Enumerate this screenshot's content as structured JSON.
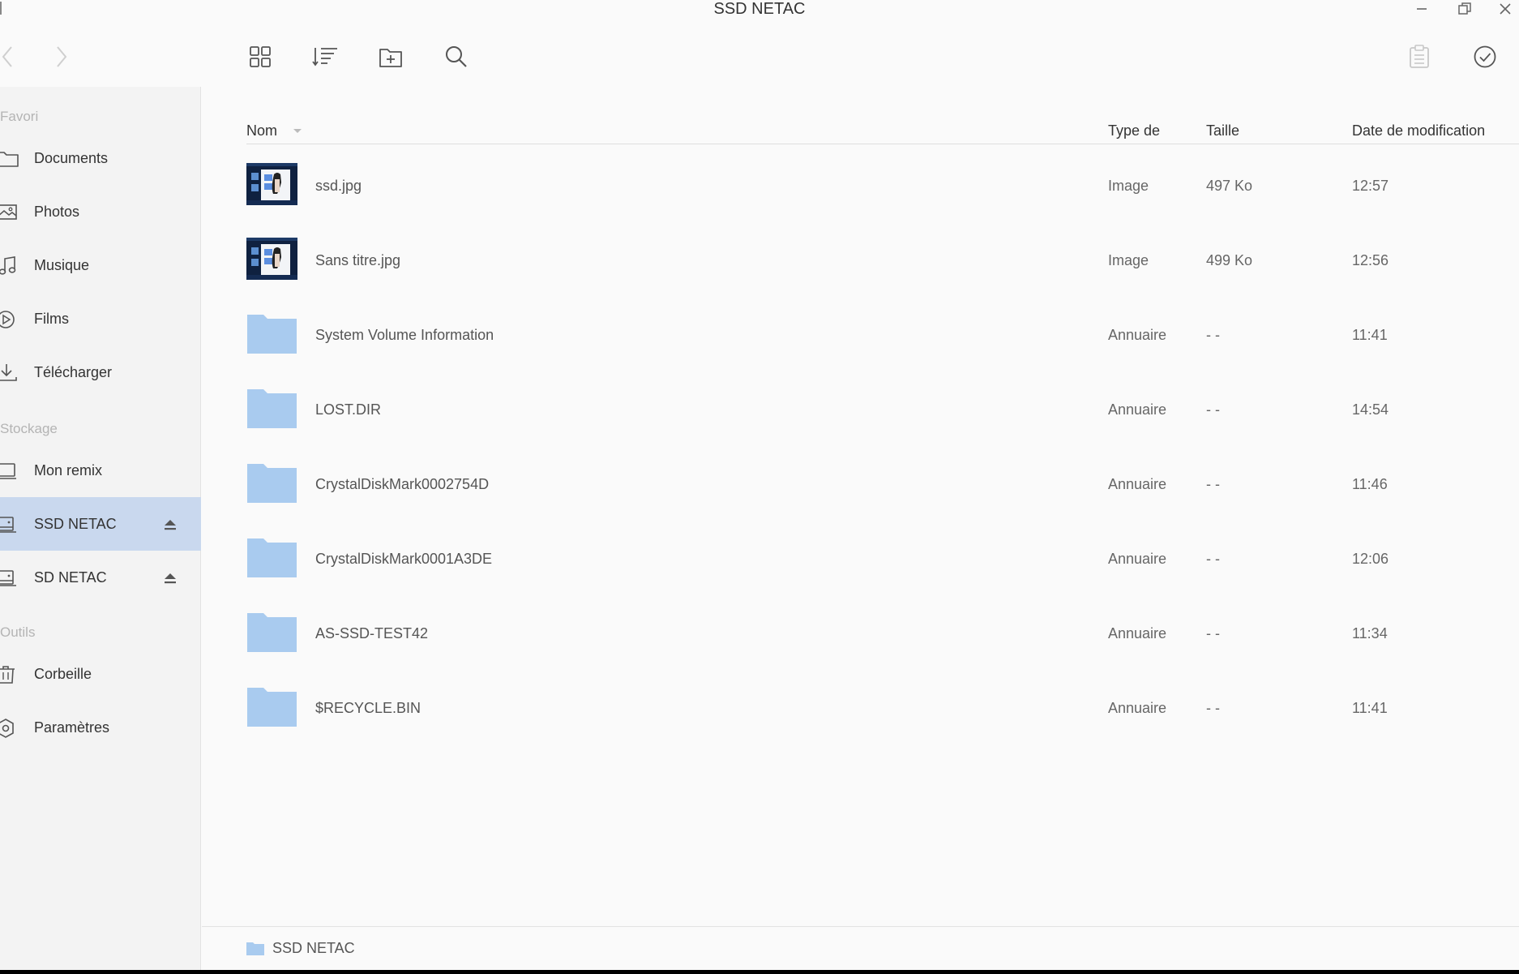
{
  "window": {
    "title": "SSD NETAC"
  },
  "sidebar": {
    "sections": [
      {
        "title": "Favori",
        "items": [
          {
            "label": "Documents",
            "icon": "folder-icon"
          },
          {
            "label": "Photos",
            "icon": "image-icon"
          },
          {
            "label": "Musique",
            "icon": "music-icon"
          },
          {
            "label": "Films",
            "icon": "play-icon"
          },
          {
            "label": "Télécharger",
            "icon": "download-icon"
          }
        ]
      },
      {
        "title": "Stockage",
        "items": [
          {
            "label": "Mon remix",
            "icon": "computer-icon"
          },
          {
            "label": "SSD NETAC",
            "icon": "drive-icon",
            "active": true,
            "eject": true
          },
          {
            "label": "SD NETAC",
            "icon": "drive-icon",
            "eject": true
          }
        ]
      },
      {
        "title": "Outils",
        "items": [
          {
            "label": "Corbeille",
            "icon": "trash-icon"
          },
          {
            "label": "Paramètres",
            "icon": "settings-icon"
          }
        ]
      }
    ]
  },
  "table": {
    "headers": {
      "name": "Nom",
      "type": "Type de",
      "size": "Taille",
      "date": "Date de modification"
    },
    "rows": [
      {
        "name": "ssd.jpg",
        "type": "Image",
        "size": "497 Ko",
        "date": "12:57",
        "kind": "image"
      },
      {
        "name": "Sans titre.jpg",
        "type": "Image",
        "size": "499 Ko",
        "date": "12:56",
        "kind": "image"
      },
      {
        "name": "System Volume Information",
        "type": "Annuaire",
        "size": "- -",
        "date": "11:41",
        "kind": "folder"
      },
      {
        "name": "LOST.DIR",
        "type": "Annuaire",
        "size": "- -",
        "date": "14:54",
        "kind": "folder"
      },
      {
        "name": "CrystalDiskMark0002754D",
        "type": "Annuaire",
        "size": "- -",
        "date": "11:46",
        "kind": "folder"
      },
      {
        "name": "CrystalDiskMark0001A3DE",
        "type": "Annuaire",
        "size": "- -",
        "date": "12:06",
        "kind": "folder"
      },
      {
        "name": "AS-SSD-TEST42",
        "type": "Annuaire",
        "size": "- -",
        "date": "11:34",
        "kind": "folder"
      },
      {
        "name": "$RECYCLE.BIN",
        "type": "Annuaire",
        "size": "- -",
        "date": "11:41",
        "kind": "folder"
      }
    ]
  },
  "statusbar": {
    "path": "SSD NETAC"
  },
  "colors": {
    "folder": "#a9cbef",
    "active_item": "#c9d8ee",
    "background": "#fafafa",
    "sidebar": "#f3f3f3"
  }
}
